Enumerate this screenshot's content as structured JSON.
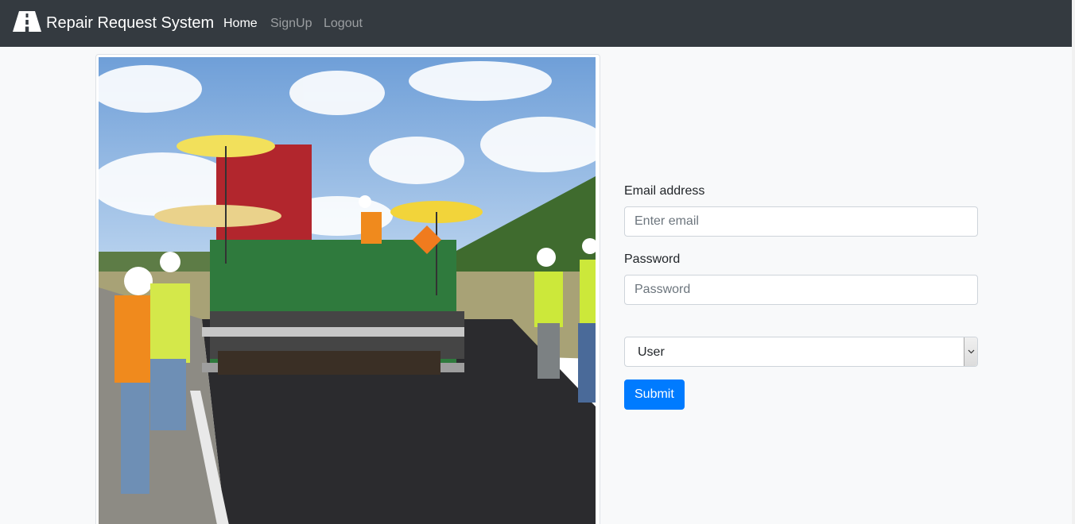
{
  "navbar": {
    "brand": "Repair Request System",
    "brand_icon": "road-icon",
    "links": [
      {
        "label": "Home",
        "active": true
      },
      {
        "label": "SignUp",
        "active": false
      },
      {
        "label": "Logout",
        "active": false
      }
    ]
  },
  "form": {
    "email_label": "Email address",
    "email_placeholder": "Enter email",
    "password_label": "Password",
    "password_placeholder": "Password",
    "role_selected": "User",
    "submit_label": "Submit"
  },
  "colors": {
    "navbar_bg": "#343a40",
    "page_bg": "#f8f9fa",
    "primary": "#007bff"
  }
}
